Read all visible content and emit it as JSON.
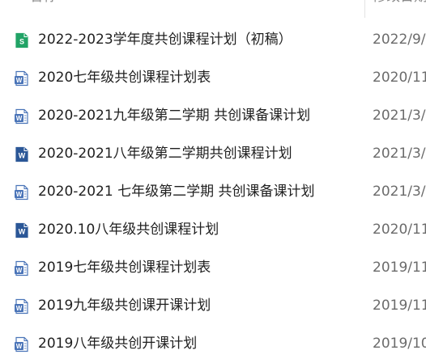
{
  "header": {
    "name_label": "名称",
    "date_label": "修改日期"
  },
  "files": [
    {
      "name": "2022-2023学年度共创课程计划（初稿）",
      "date": "2022/9/",
      "icon": "spreadsheet-icon",
      "kind": "xls"
    },
    {
      "name": "2020七年级共创课程计划表",
      "date": "2020/11",
      "icon": "word-doc-icon",
      "kind": "doc"
    },
    {
      "name": "2020-2021九年级第二学期 共创课备课计划",
      "date": "2021/3/",
      "icon": "word-doc-icon",
      "kind": "doc"
    },
    {
      "name": "2020-2021八年级第二学期共创课程计划",
      "date": "2021/3/",
      "icon": "word-docx-icon",
      "kind": "docx"
    },
    {
      "name": "2020-2021 七年级第二学期 共创课备课计划",
      "date": "2021/3/",
      "icon": "word-doc-icon",
      "kind": "doc"
    },
    {
      "name": "2020.10八年级共创课程计划",
      "date": "2020/11",
      "icon": "word-docx-icon",
      "kind": "docx"
    },
    {
      "name": "2019七年级共创课程计划表",
      "date": "2019/11",
      "icon": "word-doc-icon",
      "kind": "doc"
    },
    {
      "name": "2019九年级共创课开课计划",
      "date": "2019/11",
      "icon": "word-doc-icon",
      "kind": "doc"
    },
    {
      "name": "2019八年级共创开课计划",
      "date": "2019/10",
      "icon": "word-doc-icon",
      "kind": "doc"
    }
  ],
  "colors": {
    "xls_green": "#21a366",
    "docx_blue": "#2b5797",
    "doc_blue": "#4a74b8"
  }
}
